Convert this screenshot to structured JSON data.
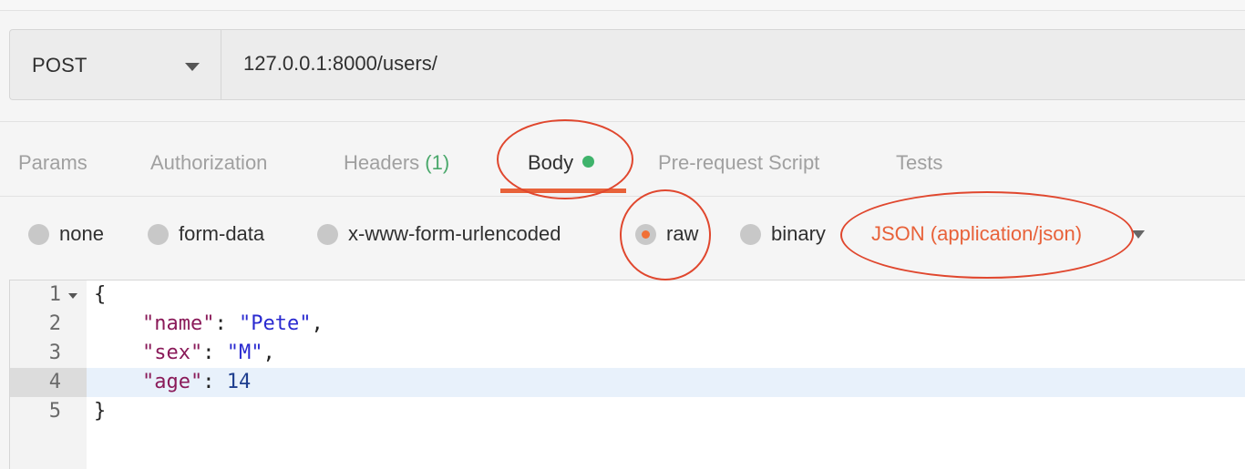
{
  "request": {
    "method": "POST",
    "url": "127.0.0.1:8000/users/"
  },
  "tabs": [
    {
      "label": "Params"
    },
    {
      "label": "Authorization"
    },
    {
      "label": "Headers",
      "count": "(1)"
    },
    {
      "label": "Body",
      "active": true
    },
    {
      "label": "Pre-request Script"
    },
    {
      "label": "Tests"
    }
  ],
  "body_types": [
    {
      "label": "none",
      "selected": false
    },
    {
      "label": "form-data",
      "selected": false
    },
    {
      "label": "x-www-form-urlencoded",
      "selected": false
    },
    {
      "label": "raw",
      "selected": true
    },
    {
      "label": "binary",
      "selected": false
    }
  ],
  "content_type": "JSON (application/json)",
  "editor": {
    "highlighted_line": 4,
    "lines": [
      {
        "num": "1",
        "text": "{"
      },
      {
        "num": "2",
        "key": "\"name\"",
        "value": "\"Pete\""
      },
      {
        "num": "3",
        "key": "\"sex\"",
        "value": "\"M\""
      },
      {
        "num": "4",
        "key": "\"age\"",
        "value": "14"
      },
      {
        "num": "5",
        "text": "}"
      }
    ]
  },
  "colors": {
    "accent": "#e8623a",
    "active_dot": "#3fb36b",
    "annotation": "#e0472e"
  }
}
